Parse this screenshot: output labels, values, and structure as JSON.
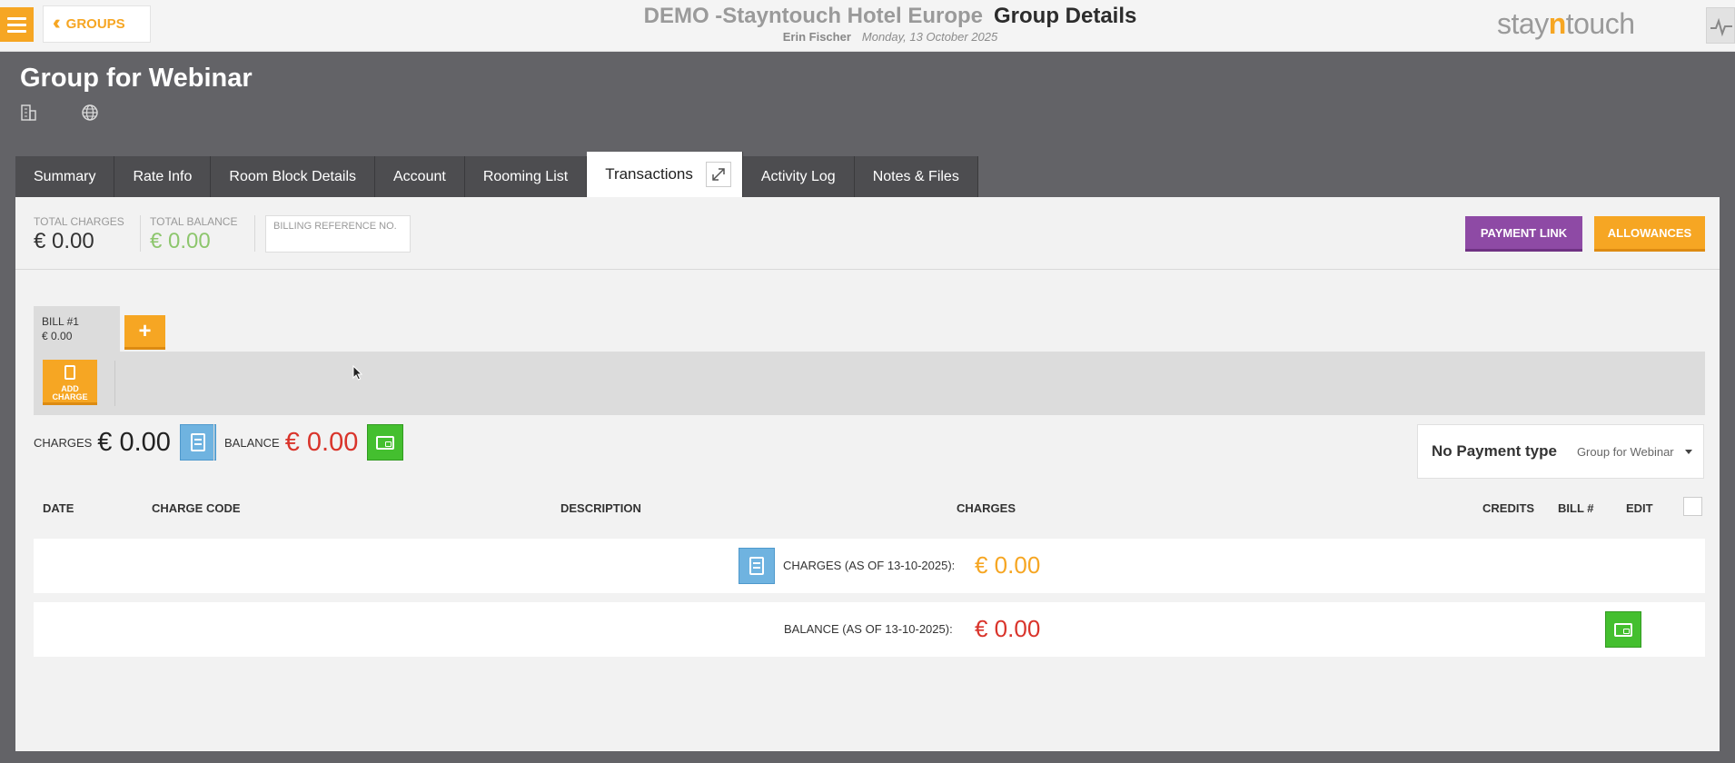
{
  "header": {
    "menu_icon": "hamburger-icon",
    "back_label": "GROUPS",
    "hotel_name": "DEMO -Stayntouch Hotel Europe",
    "page_title": "Group Details",
    "user_name": "Erin Fischer",
    "date": "Monday, 13 October 2025",
    "logo": {
      "pre": "stay",
      "mid": "n",
      "post": "touch"
    },
    "accent_color": "#f6a623"
  },
  "group": {
    "title": "Group for Webinar",
    "icons": [
      "building-icon",
      "globe-icon"
    ]
  },
  "tabs": [
    {
      "label": "Summary"
    },
    {
      "label": "Rate Info"
    },
    {
      "label": "Room Block Details"
    },
    {
      "label": "Account"
    },
    {
      "label": "Rooming List"
    },
    {
      "label": "Transactions",
      "active": true
    },
    {
      "label": "Activity Log"
    },
    {
      "label": "Notes & Files"
    }
  ],
  "summary": {
    "total_charges_label": "TOTAL CHARGES",
    "total_charges_value": "€ 0.00",
    "total_balance_label": "TOTAL BALANCE",
    "total_balance_value": "€ 0.00",
    "billing_ref_placeholder": "BILLING REFERENCE NO.",
    "payment_link_label": "PAYMENT LINK",
    "allowances_label": "ALLOWANCES",
    "payment_link_color": "#8e4aa5"
  },
  "bill": {
    "name": "BILL #1",
    "amount": "€ 0.00",
    "add_bill_label": "+",
    "add_charge_line1": "ADD",
    "add_charge_line2": "CHARGE"
  },
  "totals": {
    "charges_label": "CHARGES",
    "charges_value": "€ 0.00",
    "balance_label": "BALANCE",
    "balance_value": "€ 0.00"
  },
  "payment": {
    "type_label": "No Payment type",
    "selected": "Group for Webinar"
  },
  "table": {
    "columns": [
      "DATE",
      "CHARGE CODE",
      "DESCRIPTION",
      "CHARGES",
      "CREDITS",
      "BILL #",
      "EDIT"
    ],
    "charges_row_label": "CHARGES (AS OF 13-10-2025):",
    "charges_row_value": "€ 0.00",
    "balance_row_label": "BALANCE (AS OF 13-10-2025):",
    "balance_row_value": "€ 0.00"
  }
}
